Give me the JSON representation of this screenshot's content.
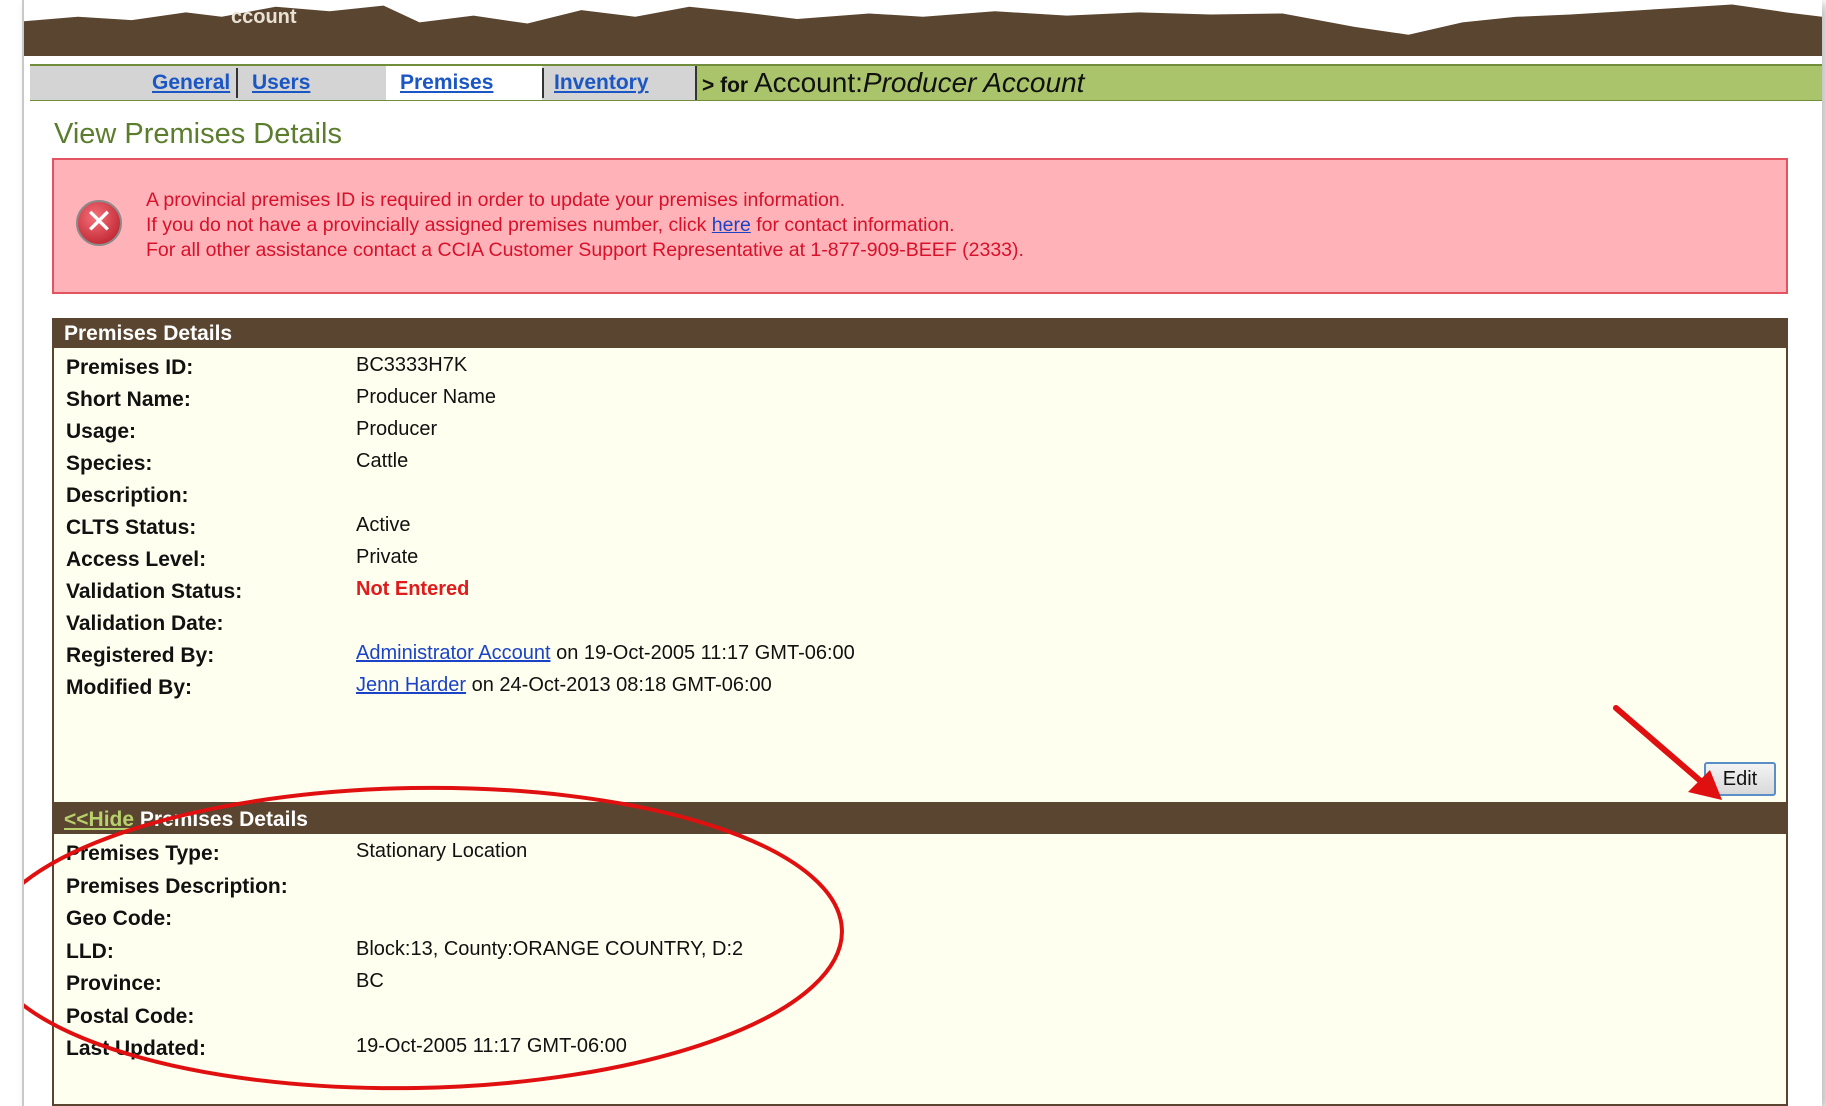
{
  "header": {
    "text": "ccount"
  },
  "tabs": [
    {
      "label": "General"
    },
    {
      "label": "Users"
    },
    {
      "label": "Premises"
    },
    {
      "label": "Inventory"
    }
  ],
  "context": {
    "prefix": "> for",
    "account_word": "Account:",
    "account_name": "Producer Account"
  },
  "page_title": "View Premises Details",
  "error": {
    "line1": "A provincial premises ID is required in order to update your premises information.",
    "line2_before": "If you do not have a provincially assigned premises number, click ",
    "line2_link": "here",
    "line2_after": " for contact information.",
    "line3": "For all other assistance contact a CCIA Customer Support Representative at 1-877-909-BEEF (2333)."
  },
  "details_panel": {
    "title": "Premises Details",
    "rows": [
      {
        "label": "Premises ID:",
        "value": "BC3333H7K"
      },
      {
        "label": "Short Name:",
        "value": "Producer Name"
      },
      {
        "label": "Usage:",
        "value": "Producer"
      },
      {
        "label": "Species:",
        "value": "Cattle"
      },
      {
        "label": "Description:",
        "value": ""
      },
      {
        "label": "CLTS Status:",
        "value": "Active"
      },
      {
        "label": "Access Level:",
        "value": "Private"
      },
      {
        "label": "Validation Status:",
        "value": "Not Entered"
      },
      {
        "label": "Validation Date:",
        "value": ""
      },
      {
        "label": "Registered By:",
        "link": "Administrator Account",
        "suffix": " on 19-Oct-2005 11:17 GMT-06:00"
      },
      {
        "label": "Modified By:",
        "link": "Jenn Harder",
        "suffix": " on 24-Oct-2013 08:18 GMT-06:00"
      }
    ],
    "edit_label": "Edit"
  },
  "more_panel": {
    "hide_link": "<<Hide",
    "title": " Premises Details",
    "rows": [
      {
        "label": "Premises Type:",
        "value": "Stationary Location"
      },
      {
        "label": "Premises Description:",
        "value": ""
      },
      {
        "label": "Geo Code:",
        "value": ""
      },
      {
        "label": "LLD:",
        "value": "Block:13, County:ORANGE COUNTRY, D:2"
      },
      {
        "label": "Province:",
        "value": "BC"
      },
      {
        "label": "Postal Code:",
        "value": ""
      },
      {
        "label": "Last Updated:",
        "value": "19-Oct-2005 11:17 GMT-06:00"
      }
    ]
  },
  "colors": {
    "brown": "#5a4530",
    "green": "#a9c46a",
    "error_bg": "#ffb3b8",
    "annotation_red": "#e01010"
  }
}
